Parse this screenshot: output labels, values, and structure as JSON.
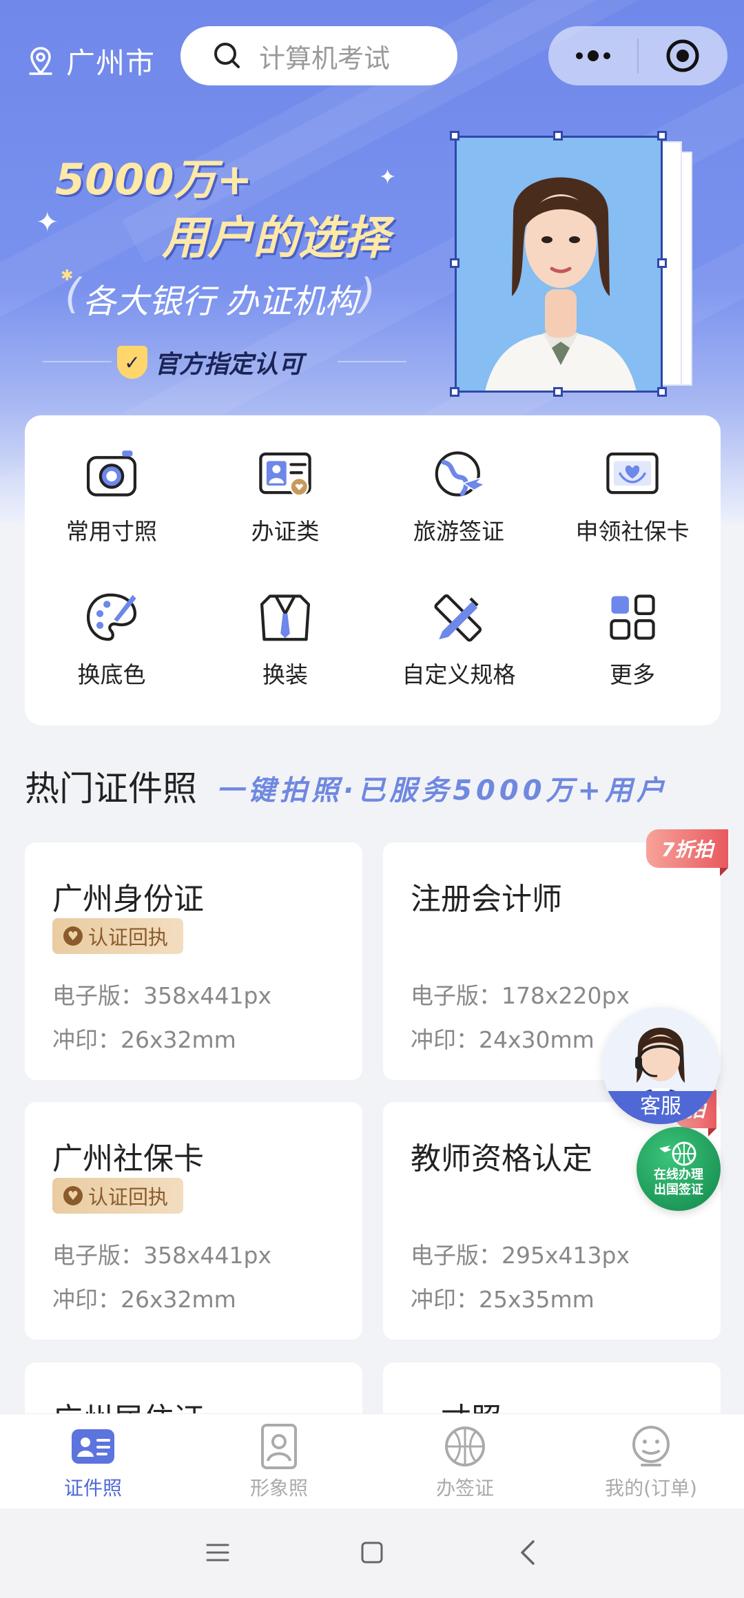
{
  "topbar": {
    "city": "广州市",
    "search_placeholder": "计算机考试"
  },
  "banner": {
    "line1": "5000万+",
    "line2": "用户的选择",
    "line3": "各大银行  办证机构",
    "line4": "官方指定认可"
  },
  "categories": [
    {
      "label": "常用寸照",
      "icon": "camera-icon"
    },
    {
      "label": "办证类",
      "icon": "id-card-icon"
    },
    {
      "label": "旅游签证",
      "icon": "globe-plane-icon"
    },
    {
      "label": "申领社保卡",
      "icon": "social-card-icon"
    },
    {
      "label": "换底色",
      "icon": "palette-icon"
    },
    {
      "label": "换装",
      "icon": "suit-icon"
    },
    {
      "label": "自定义规格",
      "icon": "ruler-pencil-icon"
    },
    {
      "label": "更多",
      "icon": "grid-icon"
    }
  ],
  "section": {
    "title": "热门证件照",
    "slogan": "一键拍照·已服务5000万+用户"
  },
  "docs": [
    {
      "name": "广州身份证",
      "badge": "认证回执",
      "spec1": "电子版：358x441px",
      "spec2": "冲印：26x32mm"
    },
    {
      "name": "注册会计师",
      "ribbon": "7折拍",
      "spec1": "电子版：178x220px",
      "spec2": "冲印：24x30mm"
    },
    {
      "name": "广州社保卡",
      "badge": "认证回执",
      "spec1": "电子版：358x441px",
      "spec2": "冲印：26x32mm"
    },
    {
      "name": "教师资格认定",
      "ribbon": "拍",
      "spec1": "电子版：295x413px",
      "spec2": "冲印：25x35mm"
    },
    {
      "name": "广州居住证"
    },
    {
      "name": "一寸照"
    }
  ],
  "floating": {
    "service_label": "客服",
    "visa_line1": "在线办理",
    "visa_line2": "出国签证"
  },
  "tabs": [
    {
      "label": "证件照",
      "icon": "id-photo-icon"
    },
    {
      "label": "形象照",
      "icon": "portrait-icon"
    },
    {
      "label": "办签证",
      "icon": "globe-icon"
    },
    {
      "label": "我的(订单)",
      "icon": "smiley-icon"
    }
  ],
  "colors": {
    "accent": "#4f68d6",
    "hero": "#6f88ea",
    "ribbon": "#e8595f",
    "badge": "#e9cca2"
  }
}
